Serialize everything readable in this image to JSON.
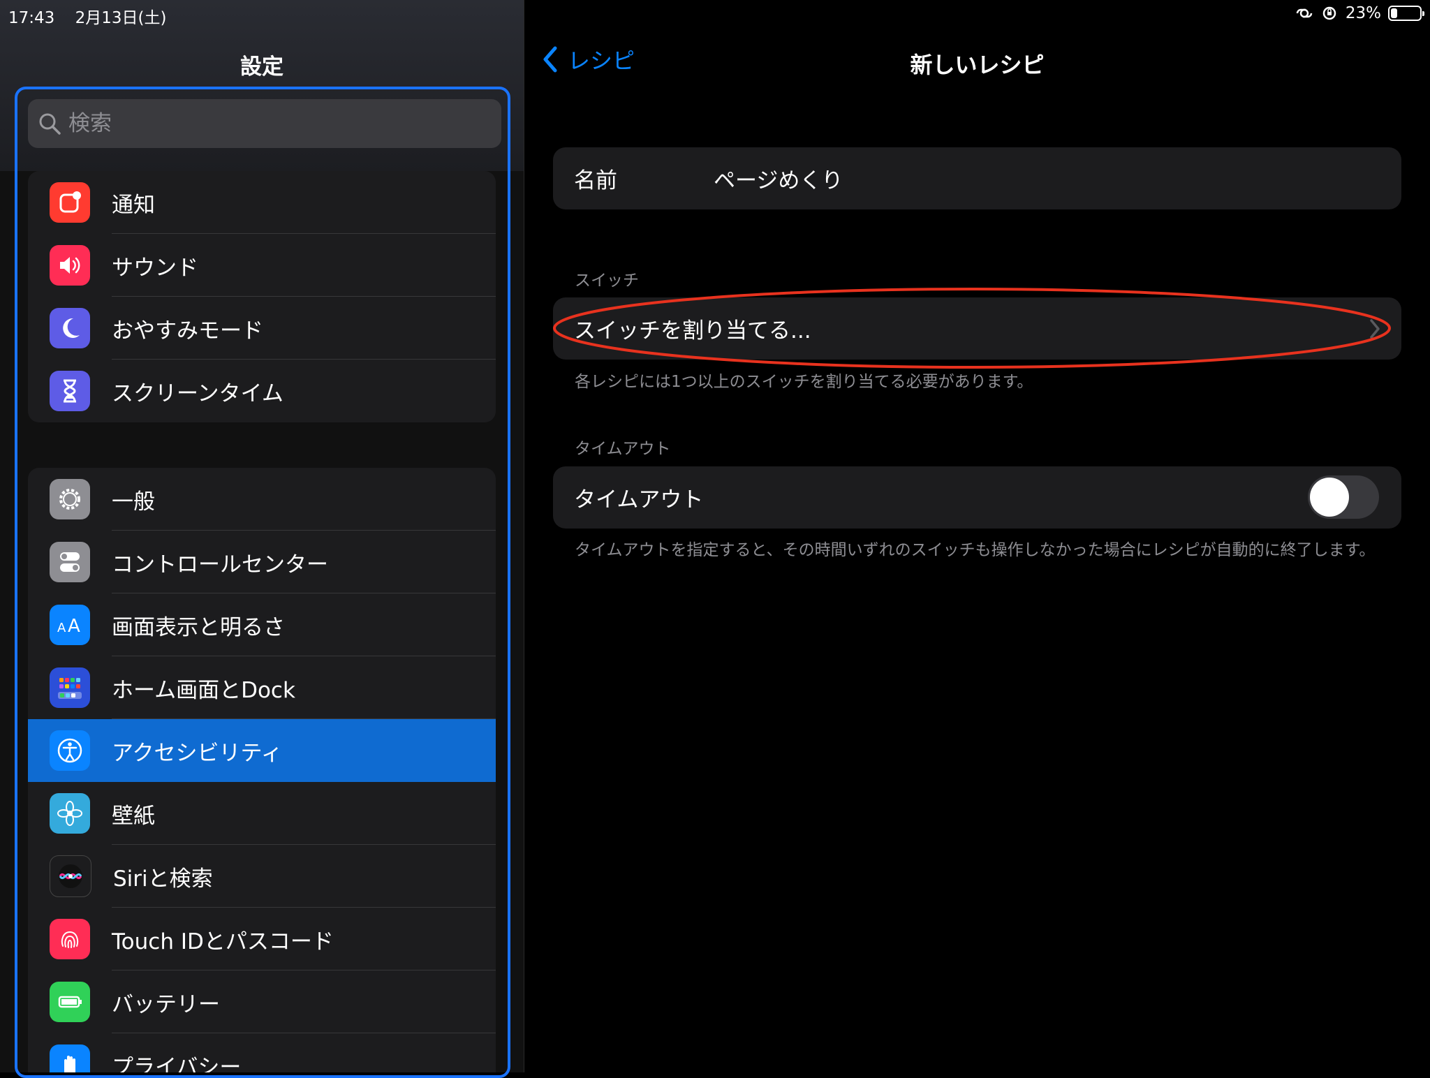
{
  "status_bar": {
    "time": "17:43",
    "date": "2月13日(土)",
    "battery_text": "23%",
    "battery_level": 0.23
  },
  "sidebar": {
    "title": "設定",
    "search_placeholder": "検索",
    "group1": [
      {
        "label": "通知",
        "icon": "notification-icon",
        "color": "#ff3b30"
      },
      {
        "label": "サウンド",
        "icon": "speaker-icon",
        "color": "#ff2d55"
      },
      {
        "label": "おやすみモード",
        "icon": "moon-icon",
        "color": "#5e5ce6"
      },
      {
        "label": "スクリーンタイム",
        "icon": "hourglass-icon",
        "color": "#5e5ce6"
      }
    ],
    "group2": [
      {
        "label": "一般",
        "icon": "gear-icon",
        "color": "#8e8e93"
      },
      {
        "label": "コントロールセンター",
        "icon": "toggles-icon",
        "color": "#8e8e93"
      },
      {
        "label": "画面表示と明るさ",
        "icon": "text-size-icon",
        "color": "#0a84ff",
        "glyph": "AA"
      },
      {
        "label": "ホーム画面とDock",
        "icon": "home-grid-icon",
        "color": "#2c4fd8"
      },
      {
        "label": "アクセシビリティ",
        "icon": "accessibility-icon",
        "color": "#0a84ff",
        "selected": true
      },
      {
        "label": "壁紙",
        "icon": "flower-icon",
        "color": "#34aadc"
      },
      {
        "label": "Siriと検索",
        "icon": "siri-icon",
        "color": "#1c1c1e"
      },
      {
        "label": "Touch IDとパスコード",
        "icon": "fingerprint-icon",
        "color": "#ff2d55"
      },
      {
        "label": "バッテリー",
        "icon": "battery-icon",
        "color": "#30d158"
      },
      {
        "label": "プライバシー",
        "icon": "hand-icon",
        "color": "#0a84ff"
      }
    ]
  },
  "detail": {
    "back_label": "レシピ",
    "title": "新しいレシピ",
    "name_label": "名前",
    "name_value": "ページめくり",
    "switch_section": "スイッチ",
    "assign_label": "スイッチを割り当てる...",
    "assign_footnote": "各レシピには1つ以上のスイッチを割り当てる必要があります。",
    "timeout_section": "タイムアウト",
    "timeout_label": "タイムアウト",
    "timeout_on": false,
    "timeout_footnote": "タイムアウトを指定すると、その時間いずれのスイッチも操作しなかった場合にレシピが自動的に終了します。"
  },
  "annotation_color": "#e8321e"
}
